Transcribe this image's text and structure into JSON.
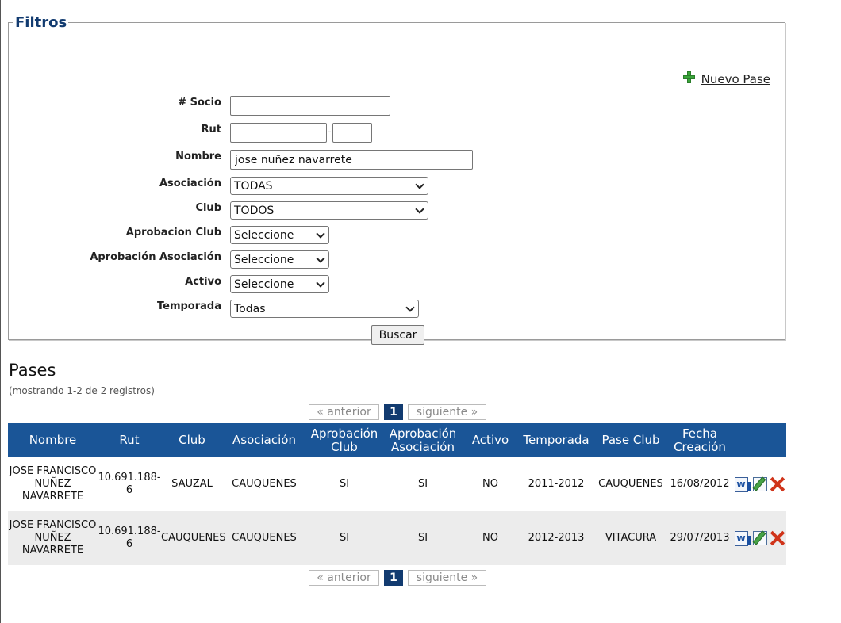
{
  "filters": {
    "legend": "Filtros",
    "new_pass_label": "Nuevo Pase",
    "socio_label": "# Socio",
    "socio_value": "",
    "rut_label": "Rut",
    "rut_value": "",
    "rut_dv_value": "",
    "rut_separator": "-",
    "nombre_label": "Nombre",
    "nombre_value": "jose nuñez navarrete",
    "asociacion_label": "Asociación",
    "asociacion_value": "TODAS",
    "club_label": "Club",
    "club_value": "TODOS",
    "aprob_club_label": "Aprobacion Club",
    "aprob_club_value": "Seleccione",
    "aprob_asoc_label": "Aprobación Asociación",
    "aprob_asoc_value": "Seleccione",
    "activo_label": "Activo",
    "activo_value": "Seleccione",
    "temporada_label": "Temporada",
    "temporada_value": "Todas",
    "search_button": "Buscar"
  },
  "results": {
    "title": "Pases",
    "records_text": "(mostrando 1-2 de 2 registros)",
    "pager": {
      "prev": "« anterior",
      "current": "1",
      "next": "siguiente »"
    },
    "columns": [
      "Nombre",
      "Rut",
      "Club",
      "Asociación",
      "Aprobación Club",
      "Aprobación Asociación",
      "Activo",
      "Temporada",
      "Pase Club",
      "Fecha Creación"
    ],
    "rows": [
      {
        "nombre": "JOSE FRANCISCO NUÑEZ NAVARRETE",
        "rut": "10.691.188-6",
        "club": "SAUZAL",
        "asociacion": "CAUQUENES",
        "aprob_club": "SI",
        "aprob_asoc": "SI",
        "activo": "NO",
        "temporada": "2011-2012",
        "pase_club": "CAUQUENES",
        "fecha": "16/08/2012"
      },
      {
        "nombre": "JOSE FRANCISCO NUÑEZ NAVARRETE",
        "rut": "10.691.188-6",
        "club": "CAUQUENES",
        "asociacion": "CAUQUENES",
        "aprob_club": "SI",
        "aprob_asoc": "SI",
        "activo": "NO",
        "temporada": "2012-2013",
        "pase_club": "VITACURA",
        "fecha": "29/07/2013"
      }
    ],
    "row_actions": [
      "word-document-icon",
      "edit-icon",
      "delete-icon"
    ]
  },
  "colors": {
    "header_bg": "#1a5597",
    "legend": "#123b70",
    "add_icon": "#3aa53a",
    "delete_icon": "#d0341a",
    "alt_row": "#ececec"
  }
}
